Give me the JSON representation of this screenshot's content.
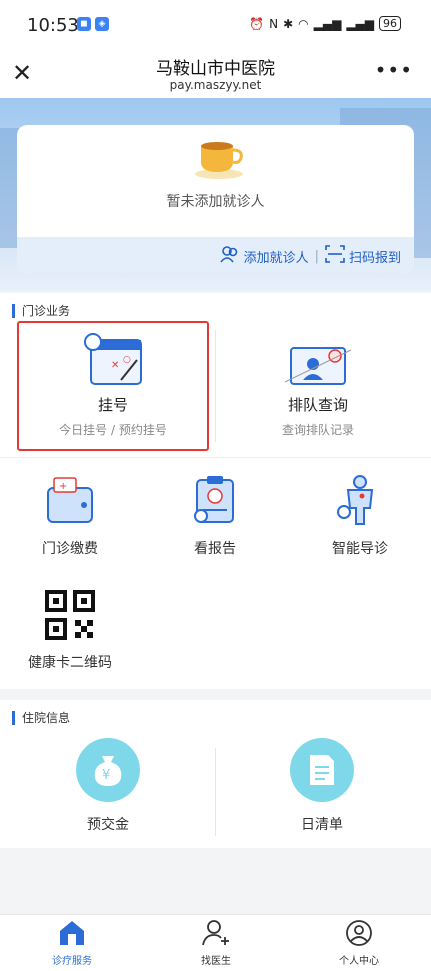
{
  "status_bar": {
    "time": "10:53",
    "battery": "96"
  },
  "nav": {
    "title": "马鞍山市中医院",
    "subtitle": "pay.maszyy.net",
    "more": "•••"
  },
  "patient": {
    "empty_text": "暂未添加就诊人",
    "add_label": "添加就诊人",
    "separator": "|",
    "scan_label": "扫码报到"
  },
  "outpatient": {
    "section_title": "门诊业务",
    "register": {
      "title": "挂号",
      "subtitle": "今日挂号 / 预约挂号"
    },
    "queue": {
      "title": "排队查询",
      "subtitle": "查询排队记录"
    },
    "grid": [
      {
        "label": "门诊缴费"
      },
      {
        "label": "看报告"
      },
      {
        "label": "智能导诊"
      },
      {
        "label": "健康卡二维码"
      }
    ]
  },
  "inpatient": {
    "section_title": "住院信息",
    "deposit": {
      "label": "预交金",
      "symbol": "¥"
    },
    "daily_list": {
      "label": "日清单"
    }
  },
  "tabs": [
    {
      "label": "诊疗服务"
    },
    {
      "label": "找医生"
    },
    {
      "label": "个人中心"
    }
  ],
  "colors": {
    "accent": "#2b6cd6",
    "highlight": "#e53935",
    "icon_circle": "#7fd8ea"
  }
}
